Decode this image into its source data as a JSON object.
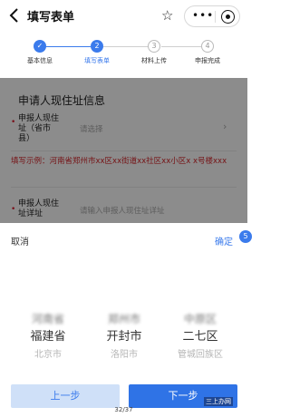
{
  "nav": {
    "back_icon": "chevron-left-icon",
    "title": "填写表单",
    "star_icon": "star-icon",
    "more_label": "•••",
    "close_icon": "target-close-icon"
  },
  "steps": [
    {
      "number": "✓",
      "label": "基本信息",
      "state": "done"
    },
    {
      "number": "2",
      "label": "填写表单",
      "state": "active"
    },
    {
      "number": "3",
      "label": "材料上传",
      "state": "todo"
    },
    {
      "number": "4",
      "label": "申报完成",
      "state": "todo"
    }
  ],
  "form": {
    "section_title": "申请人现住址信息",
    "field1": {
      "required_mark": "•",
      "label_lines": [
        "申报人现住",
        "址（省市",
        "县）"
      ],
      "placeholder": "请选择",
      "chevron": "›"
    },
    "hint": "填写示例：河南省郑州市xx区xx街道xx社区xx小区x x号楼xxx",
    "field2": {
      "required_mark": "•",
      "label_lines": [
        "申报人现住",
        "址详址"
      ],
      "placeholder": "请输入申报人现住址详址"
    }
  },
  "picker": {
    "cancel_label": "取消",
    "confirm_label": "确定",
    "badge": "5",
    "columns": [
      {
        "above": "河南省",
        "selected": "福建省",
        "below": "北京市"
      },
      {
        "above": "郑州市",
        "selected": "开封市",
        "below": "洛阳市"
      },
      {
        "above": "中原区",
        "selected": "二七区",
        "below": "管城回族区"
      }
    ]
  },
  "buttons": {
    "prev_label": "上一步",
    "next_label": "下一步"
  },
  "watermark": "三上办网",
  "page_counter": "32/37",
  "colors": {
    "accent": "#3b7bec",
    "hint_red": "#d7262b",
    "overlay": "rgba(0,0,0,0.45)"
  }
}
